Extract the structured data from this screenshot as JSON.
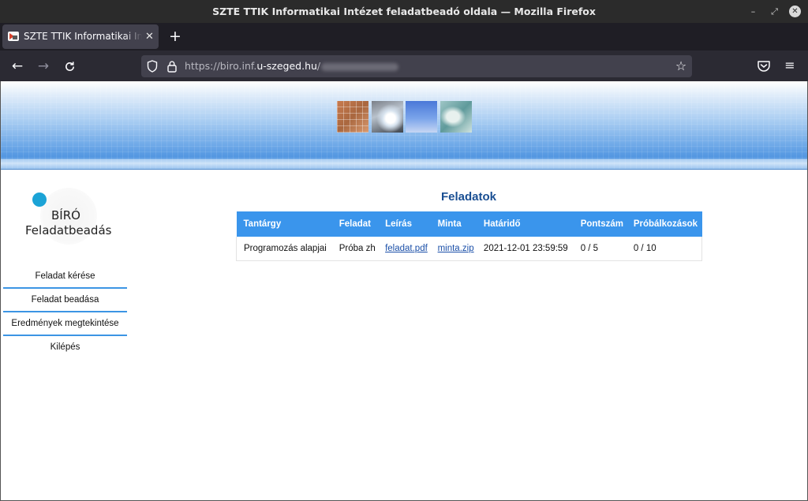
{
  "window": {
    "title": "SZTE TTIK Informatikai Intézet feladatbeadó oldala — Mozilla Firefox"
  },
  "tab": {
    "label": "SZTE TTIK Informatikai Intézet feladatbeadó oldala"
  },
  "urlbar": {
    "scheme": "https://biro.inf.",
    "host": "u-szeged.hu",
    "path": "/"
  },
  "logo": {
    "line1": "BÍRÓ",
    "line2": "Feladatbeadás"
  },
  "sidemenu": {
    "items": [
      {
        "label": "Feladat kérése"
      },
      {
        "label": "Feladat beadása"
      },
      {
        "label": "Eredmények megtekintése"
      },
      {
        "label": "Kilépés"
      }
    ]
  },
  "main": {
    "heading": "Feladatok",
    "columns": [
      "Tantárgy",
      "Feladat",
      "Leírás",
      "Minta",
      "Határidő",
      "Pontszám",
      "Próbálkozások"
    ],
    "rows": [
      {
        "subject": "Programozás alapjai",
        "task": "Próba zh",
        "description": "feladat.pdf",
        "sample": "minta.zip",
        "deadline": "2021-12-01 23:59:59",
        "points": "0 / 5",
        "attempts": "0 / 10"
      }
    ]
  },
  "colors": {
    "table_header": "#3a95ec",
    "heading": "#1a4f93",
    "menu_separator": "#3c95e4",
    "logo_dot": "#1ba3d6"
  }
}
